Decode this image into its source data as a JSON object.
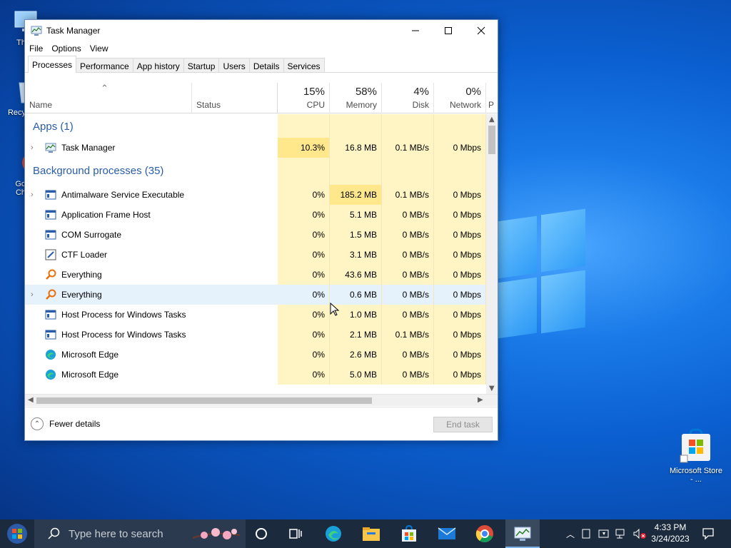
{
  "desktop": {
    "icons": [
      {
        "label": "Th"
      },
      {
        "label": "Recy"
      },
      {
        "label": "Go\nCh"
      },
      {
        "label": "Microsoft Store - ..."
      }
    ]
  },
  "window": {
    "title": "Task Manager",
    "menu": [
      "File",
      "Options",
      "View"
    ],
    "tabs": [
      "Processes",
      "Performance",
      "App history",
      "Startup",
      "Users",
      "Details",
      "Services"
    ],
    "active_tab": "Processes",
    "columns": {
      "name": "Name",
      "status": "Status",
      "cpu": {
        "pct": "15%",
        "label": "CPU"
      },
      "memory": {
        "pct": "58%",
        "label": "Memory"
      },
      "disk": {
        "pct": "4%",
        "label": "Disk"
      },
      "network": {
        "pct": "0%",
        "label": "Network"
      },
      "power_partial": "P"
    },
    "groups": {
      "apps": "Apps (1)",
      "background": "Background processes (35)"
    },
    "apps": [
      {
        "name": "Task Manager",
        "cpu": "10.3%",
        "memory": "16.8 MB",
        "disk": "0.1 MB/s",
        "network": "0 Mbps",
        "icon": "task-manager-icon",
        "expandable": true
      }
    ],
    "background": [
      {
        "name": "Antimalware Service Executable",
        "cpu": "0%",
        "memory": "185.2 MB",
        "disk": "0.1 MB/s",
        "network": "0 Mbps",
        "icon": "service-window-icon",
        "expandable": true
      },
      {
        "name": "Application Frame Host",
        "cpu": "0%",
        "memory": "5.1 MB",
        "disk": "0 MB/s",
        "network": "0 Mbps",
        "icon": "service-window-icon",
        "expandable": false
      },
      {
        "name": "COM Surrogate",
        "cpu": "0%",
        "memory": "1.5 MB",
        "disk": "0 MB/s",
        "network": "0 Mbps",
        "icon": "service-window-icon",
        "expandable": false
      },
      {
        "name": "CTF Loader",
        "cpu": "0%",
        "memory": "3.1 MB",
        "disk": "0 MB/s",
        "network": "0 Mbps",
        "icon": "ctf-pen-icon",
        "expandable": false
      },
      {
        "name": "Everything",
        "cpu": "0%",
        "memory": "43.6 MB",
        "disk": "0 MB/s",
        "network": "0 Mbps",
        "icon": "everything-search-icon",
        "expandable": false
      },
      {
        "name": "Everything",
        "cpu": "0%",
        "memory": "0.6 MB",
        "disk": "0 MB/s",
        "network": "0 Mbps",
        "icon": "everything-search-icon",
        "expandable": true
      },
      {
        "name": "Host Process for Windows Tasks",
        "cpu": "0%",
        "memory": "1.0 MB",
        "disk": "0 MB/s",
        "network": "0 Mbps",
        "icon": "service-window-icon",
        "expandable": false
      },
      {
        "name": "Host Process for Windows Tasks",
        "cpu": "0%",
        "memory": "2.1 MB",
        "disk": "0.1 MB/s",
        "network": "0 Mbps",
        "icon": "service-window-icon",
        "expandable": false
      },
      {
        "name": "Microsoft Edge",
        "cpu": "0%",
        "memory": "2.6 MB",
        "disk": "0 MB/s",
        "network": "0 Mbps",
        "icon": "edge-icon",
        "expandable": false
      },
      {
        "name": "Microsoft Edge",
        "cpu": "0%",
        "memory": "5.0 MB",
        "disk": "0 MB/s",
        "network": "0 Mbps",
        "icon": "edge-icon",
        "expandable": false
      }
    ],
    "footer": {
      "fewer_details": "Fewer details",
      "end_task": "End task"
    }
  },
  "taskbar": {
    "search_placeholder": "Type here to search",
    "time": "4:33 PM",
    "date": "3/24/2023"
  },
  "colors": {
    "group_title": "#2a5ca8",
    "heat": "#fff4c4",
    "heat_strong": "#ffe88c",
    "taskbar": "#1b2a3d"
  }
}
